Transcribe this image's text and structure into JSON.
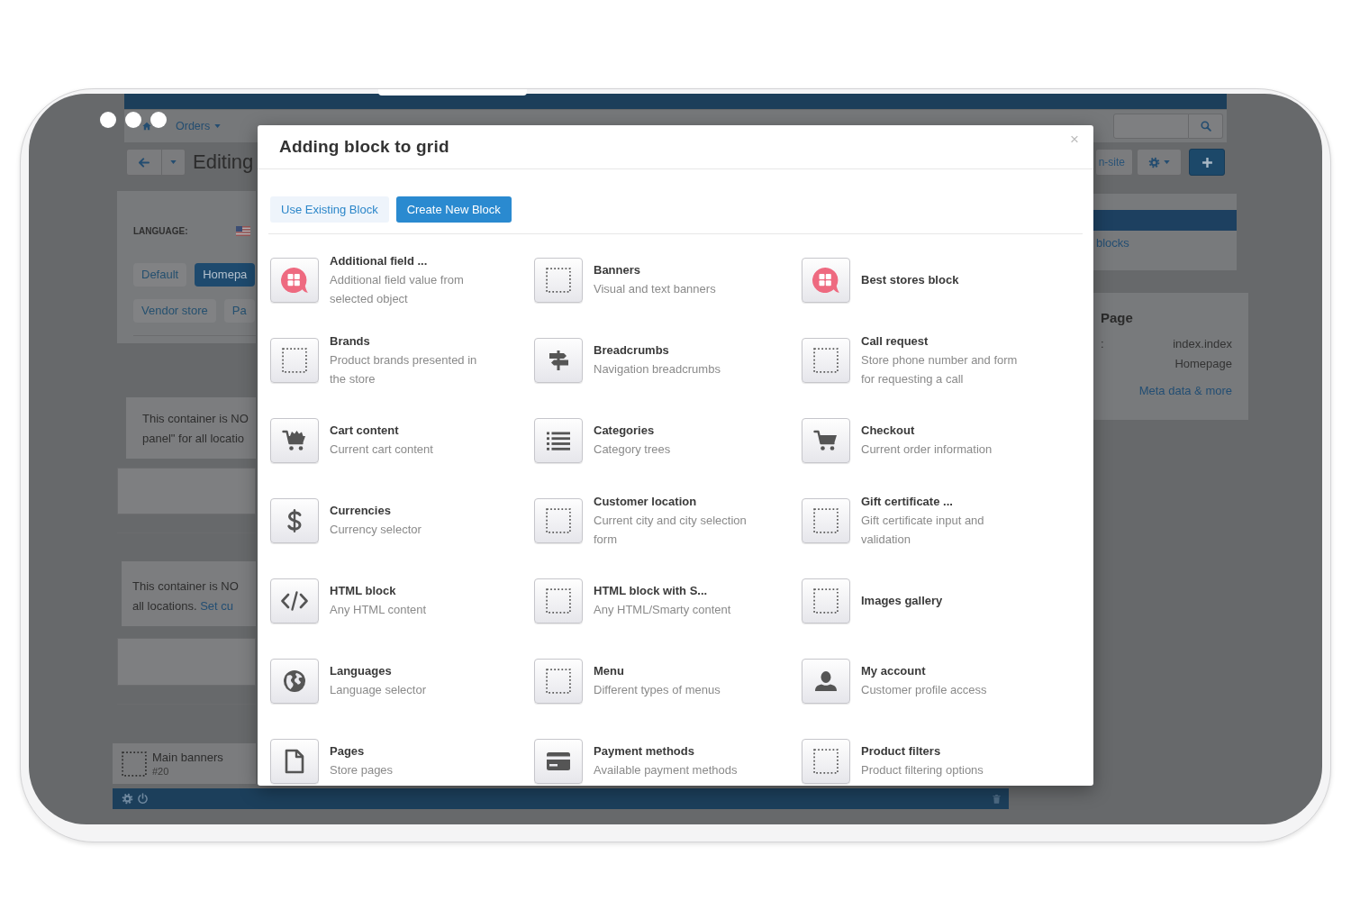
{
  "app": {
    "menu": [
      {
        "label": "Orders"
      }
    ],
    "page_title": "Editing",
    "site_button": "n-site",
    "language_label": "LANGUAGE:",
    "layout_tabs": [
      {
        "label": "Default",
        "selected": false
      },
      {
        "label": "Homepa",
        "selected": true
      },
      {
        "label": "Vendor store",
        "selected": false
      },
      {
        "label": "Pa",
        "selected": false
      }
    ],
    "containers": [
      {
        "lines": [
          "This container is NO",
          "panel\" for all locatio"
        ]
      },
      {
        "lines": [
          "This container is NO",
          "all locations."
        ],
        "link": "Set cu"
      }
    ],
    "block": {
      "title": "Main banners",
      "number": "#20"
    },
    "side_link": "blocks",
    "page_panel": {
      "title": "Page",
      "rows": [
        {
          "label": ":",
          "value": "index.index"
        },
        {
          "value": "Homepage"
        }
      ],
      "link": "Meta data & more"
    }
  },
  "modal": {
    "title": "Adding block to grid",
    "close": "×",
    "tabs": [
      {
        "label": "Use Existing Block",
        "selected": false
      },
      {
        "label": "Create New Block",
        "selected": true
      }
    ],
    "blocks": [
      {
        "title": "Additional field ...",
        "description": "Additional field value from selected object",
        "kind": "addon"
      },
      {
        "title": "Banners",
        "description": "Visual and text banners",
        "kind": "placeholder"
      },
      {
        "title": "Best stores block",
        "kind": "addon"
      },
      {
        "title": "Brands",
        "description": "Product brands presented in the store",
        "kind": "placeholder"
      },
      {
        "title": "Breadcrumbs",
        "description": "Navigation breadcrumbs",
        "kind": "signpost"
      },
      {
        "title": "Call request",
        "description": "Store phone number and form for requesting a call",
        "kind": "placeholder"
      },
      {
        "title": "Cart content",
        "description": "Current cart content",
        "kind": "cart-full"
      },
      {
        "title": "Categories",
        "description": "Category trees",
        "kind": "list"
      },
      {
        "title": "Checkout",
        "description": "Current order information",
        "kind": "cart"
      },
      {
        "title": "Currencies",
        "description": "Currency selector",
        "kind": "dollar"
      },
      {
        "title": "Customer location",
        "description": "Current city and city selection form",
        "kind": "placeholder"
      },
      {
        "title": "Gift certificate ...",
        "description": "Gift certificate input and validation",
        "kind": "placeholder"
      },
      {
        "title": "HTML block",
        "description": "Any HTML content",
        "kind": "code"
      },
      {
        "title": "HTML block with S...",
        "description": "Any HTML/Smarty content",
        "kind": "placeholder"
      },
      {
        "title": "Images gallery",
        "kind": "placeholder"
      },
      {
        "title": "Languages",
        "description": "Language selector",
        "kind": "globe"
      },
      {
        "title": "Menu",
        "description": "Different types of menus",
        "kind": "placeholder"
      },
      {
        "title": "My account",
        "description": "Customer profile access",
        "kind": "user"
      },
      {
        "title": "Pages",
        "description": "Store pages",
        "kind": "page"
      },
      {
        "title": "Payment methods",
        "description": "Available payment methods",
        "kind": "card"
      },
      {
        "title": "Product filters",
        "description": "Product filtering options",
        "kind": "placeholder"
      }
    ]
  }
}
